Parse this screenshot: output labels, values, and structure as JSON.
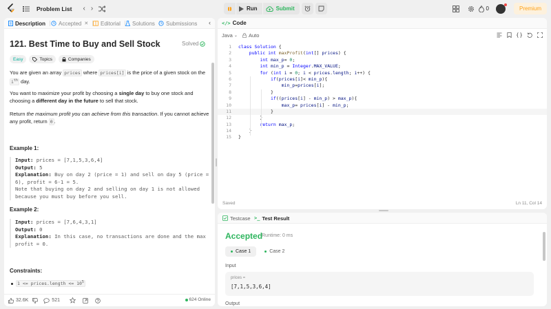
{
  "nav": {
    "problem_list": "Problem List",
    "run_label": "Run",
    "submit_label": "Submit",
    "streak": "0",
    "premium": "Premium"
  },
  "left_tabs": [
    {
      "label": "Description"
    },
    {
      "label": "Accepted"
    },
    {
      "label": "Editorial"
    },
    {
      "label": "Solutions"
    },
    {
      "label": "Submissions"
    }
  ],
  "problem": {
    "title": "121. Best Time to Buy and Sell Stock",
    "solved": "Solved",
    "difficulty": "Easy",
    "topics": "Topics",
    "companies": "Companies",
    "p1_a": "You are given an array ",
    "p1_code1": "prices",
    "p1_b": " where ",
    "p1_code2": "prices[i]",
    "p1_c": " is the price of a given stock on the ",
    "p1_code3": "i",
    "p1_sup": "th",
    "p1_d": " day.",
    "p2_a": "You want to maximize your profit by choosing a ",
    "p2_b1": "single day",
    "p2_c": " to buy one stock and choosing a ",
    "p2_b2": "different day in the future",
    "p2_d": " to sell that stock.",
    "p3_a": "Return ",
    "p3_i": "the maximum profit you can achieve from this transaction",
    "p3_b": ". If you cannot achieve any profit, return ",
    "p3_code": "0",
    "p3_c": "."
  },
  "example1": {
    "title": "Example 1:",
    "input_label": "Input:",
    "input": " prices = [7,1,5,3,6,4]",
    "output_label": "Output:",
    "output": " 5",
    "expl_label": "Explanation:",
    "expl": " Buy on day 2 (price = 1) and sell on day 5 (price = 6), profit = 6-1 = 5.\nNote that buying on day 2 and selling on day 1 is not allowed because you must buy before you sell."
  },
  "example2": {
    "title": "Example 2:",
    "input_label": "Input:",
    "input": " prices = [7,6,4,3,1]",
    "output_label": "Output:",
    "output": " 0",
    "expl_label": "Explanation:",
    "expl": " In this case, no transactions are done and the max profit = 0."
  },
  "constraints": {
    "title": "Constraints:",
    "c1": "1 <= prices.length <= 10",
    "c1_sup": "5"
  },
  "left_footer": {
    "likes": "32.6K",
    "comments": "521",
    "online": "624 Online"
  },
  "code": {
    "header": "Code",
    "language": "Java",
    "mode": "Auto",
    "saved": "Saved",
    "position": "Ln 11, Col 14"
  },
  "result": {
    "testcase_tab": "Testcase",
    "result_tab": "Test Result",
    "status": "Accepted",
    "runtime": "Runtime: 0 ms",
    "case1": "Case 1",
    "case2": "Case 2",
    "input_label": "Input",
    "var_name": "prices =",
    "var_value": "[7,1,5,3,6,4]",
    "output_label": "Output"
  },
  "colors": {
    "accepted": "#2db55d",
    "easy": "#00af9b",
    "premium": "#ffa116",
    "keyword": "#0000ff"
  }
}
